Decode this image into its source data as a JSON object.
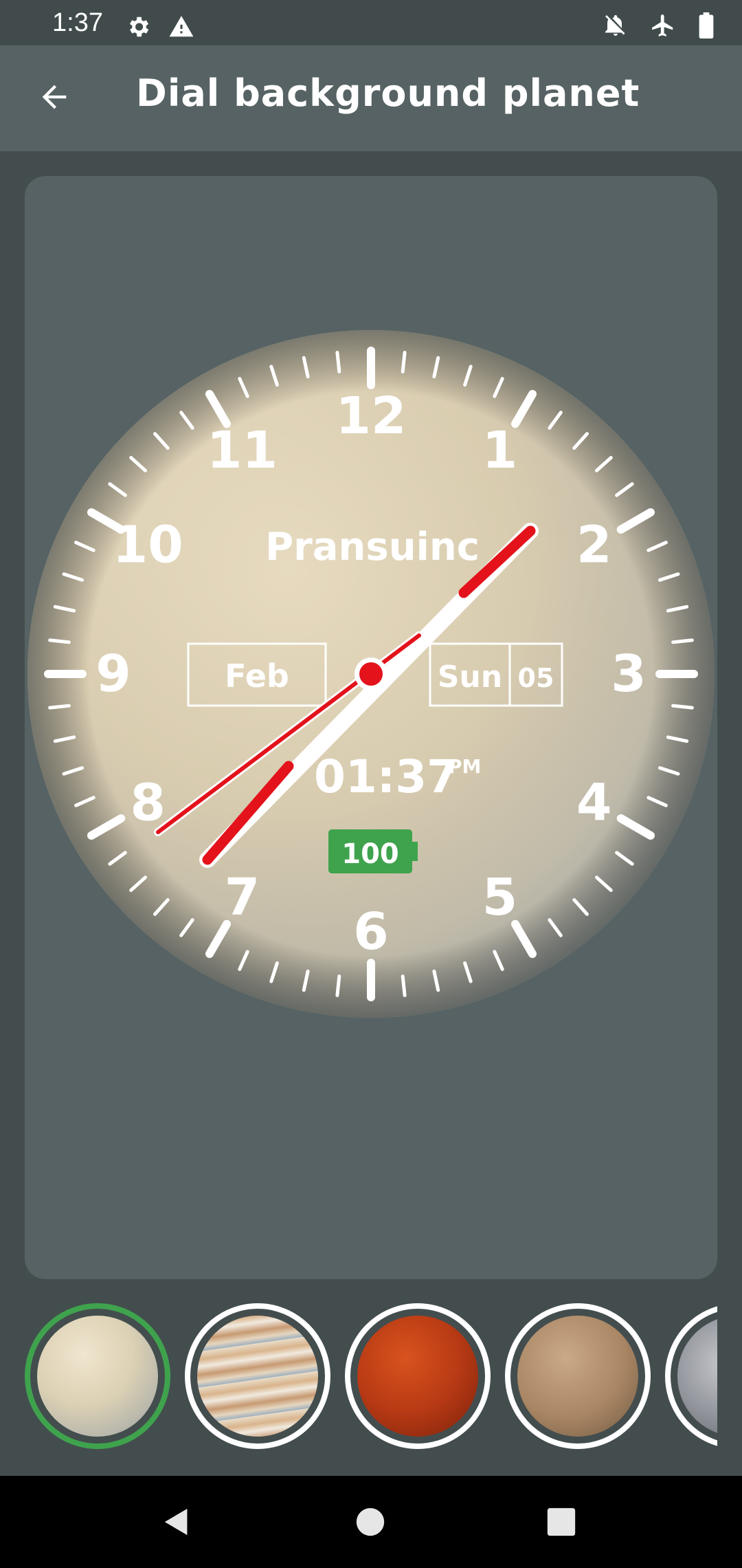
{
  "status_bar": {
    "time": "1:37",
    "left_icons": [
      "gear-icon",
      "warning-icon"
    ],
    "right_icons": [
      "notifications-off-icon",
      "airplane-icon",
      "battery-icon"
    ]
  },
  "app_bar": {
    "back_icon": "arrow-back-icon",
    "title": "Dial background planet"
  },
  "clock": {
    "brand": "Pransuinc",
    "month": "Feb",
    "weekday": "Sun",
    "day": "05",
    "time": "01:37",
    "ampm": "PM",
    "battery": "100",
    "numbers": [
      "12",
      "1",
      "2",
      "3",
      "4",
      "5",
      "6",
      "7",
      "8",
      "9",
      "10",
      "11"
    ],
    "colors": {
      "hand_accent": "#e3121b",
      "battery_green": "#3fa34d"
    }
  },
  "planets": [
    {
      "name": "venus",
      "selected": true
    },
    {
      "name": "jupiter",
      "selected": false
    },
    {
      "name": "mars",
      "selected": false
    },
    {
      "name": "mercury",
      "selected": false
    },
    {
      "name": "moon",
      "selected": false
    }
  ],
  "colors": {
    "selected_ring": "#3fa34d",
    "ring": "#ffffff"
  },
  "nav_bar": {
    "buttons": [
      "back-triangle-icon",
      "home-circle-icon",
      "recents-square-icon"
    ]
  }
}
